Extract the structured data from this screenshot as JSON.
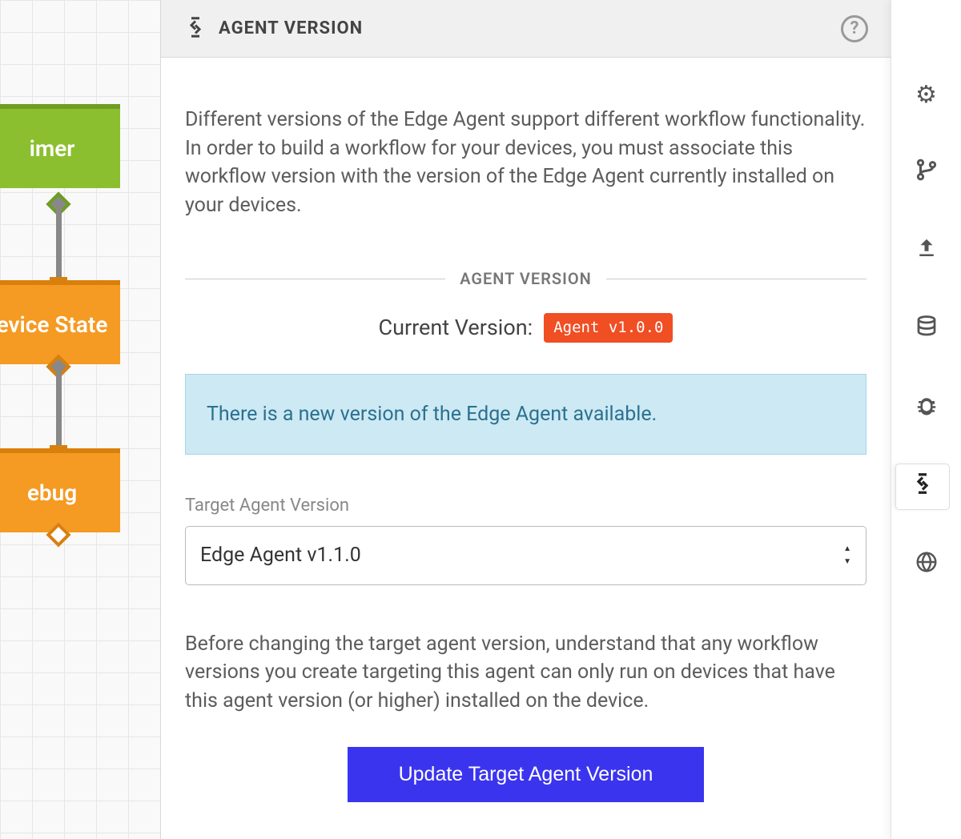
{
  "canvas": {
    "nodes": {
      "timer": "imer",
      "state": "evice State",
      "debug": "ebug"
    }
  },
  "panel": {
    "title": "AGENT VERSION",
    "intro": "Different versions of the Edge Agent support different workflow functionality. In order to build a workflow for your devices, you must associate this workflow version with the version of the Edge Agent currently installed on your devices.",
    "section_label": "AGENT VERSION",
    "current_label": "Current Version:",
    "current_badge": "Agent v1.0.0",
    "alert": "There is a new version of the Edge Agent available.",
    "target_label": "Target Agent Version",
    "target_value": "Edge Agent v1.1.0",
    "note": "Before changing the target agent version, understand that any workflow versions you create targeting this agent can only run on devices that have this agent version (or higher) installed on the device.",
    "button": "Update Target Agent Version",
    "help": "?"
  },
  "rail": {
    "items": [
      "settings",
      "version",
      "upload",
      "storage",
      "debug",
      "agent",
      "globe"
    ]
  }
}
